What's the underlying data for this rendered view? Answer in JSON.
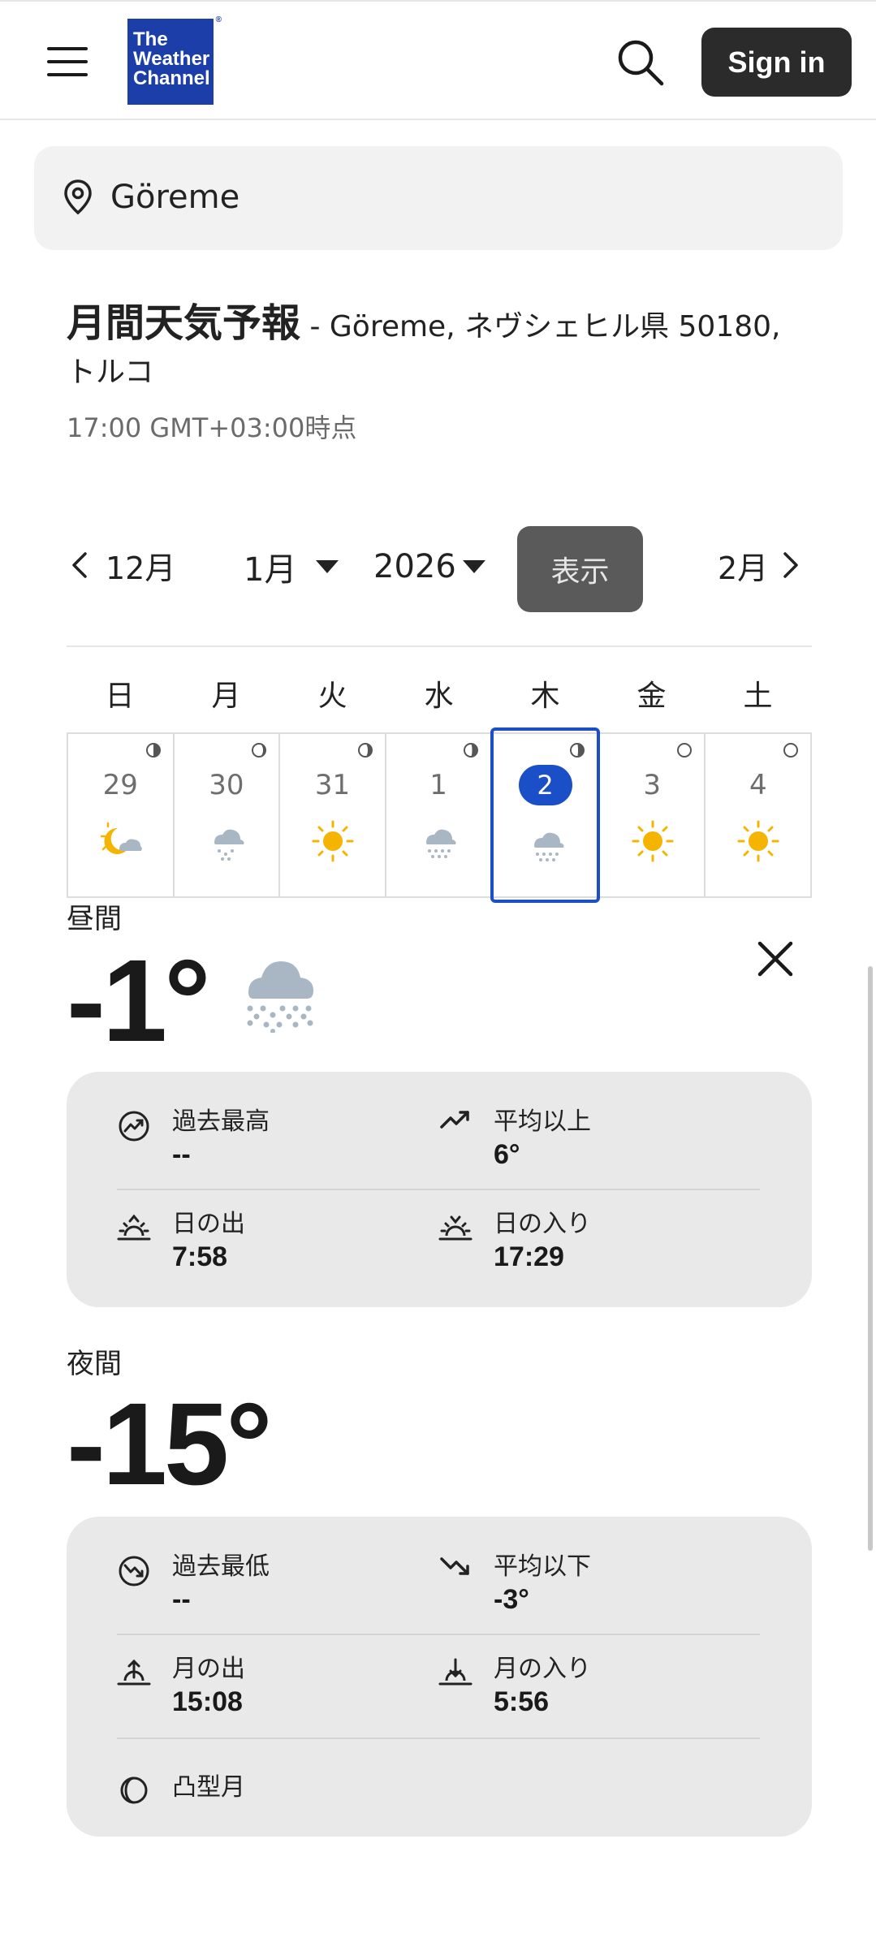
{
  "header": {
    "logo_lines": [
      "The",
      "Weather",
      "Channel"
    ],
    "logo_reg": "®",
    "signin_label": "Sign in",
    "brand_color": "#1b3ea8"
  },
  "location": {
    "name": "Göreme"
  },
  "heading": {
    "title": "月間天気予報",
    "subtitle": " - Göreme, ネヴシェヒル県 50180, トルコ",
    "time": "17:00 GMT+03:00時点"
  },
  "nav": {
    "prev_label": "12月",
    "month_value": "1月",
    "year_value": "2026",
    "show_label": "表示",
    "next_label": "2月"
  },
  "weekdays": [
    "日",
    "月",
    "火",
    "水",
    "木",
    "金",
    "土"
  ],
  "days": [
    {
      "date": "29",
      "weather_icon": "partly-cloudy-night-icon"
    },
    {
      "date": "30",
      "weather_icon": "snow-icon"
    },
    {
      "date": "31",
      "weather_icon": "sunny-icon"
    },
    {
      "date": "1",
      "weather_icon": "snow-icon"
    },
    {
      "date": "2",
      "weather_icon": "snow-icon",
      "selected": true
    },
    {
      "date": "3",
      "weather_icon": "sunny-icon"
    },
    {
      "date": "4",
      "weather_icon": "sunny-icon"
    }
  ],
  "day": {
    "label": "昼間",
    "temp": "-1°",
    "weather_icon": "snow-icon",
    "record_high_label": "過去最高",
    "record_high_value": "--",
    "avg_above_label": "平均以上",
    "avg_above_value": "6°",
    "sunrise_label": "日の出",
    "sunrise_value": "7:58",
    "sunset_label": "日の入り",
    "sunset_value": "17:29"
  },
  "night": {
    "label": "夜間",
    "temp": "-15°",
    "record_low_label": "過去最低",
    "record_low_value": "--",
    "avg_below_label": "平均以下",
    "avg_below_value": "-3°",
    "moonrise_label": "月の出",
    "moonrise_value": "15:08",
    "moonset_label": "月の入り",
    "moonset_value": "5:56",
    "moon_phase_label": "凸型月"
  },
  "colors": {
    "selected_day": "#1b4fc7",
    "signin_bg": "#2b2b2b",
    "show_bg": "#5a5a5a",
    "sun": "#f5b400",
    "cloud": "#a9b6c3"
  }
}
